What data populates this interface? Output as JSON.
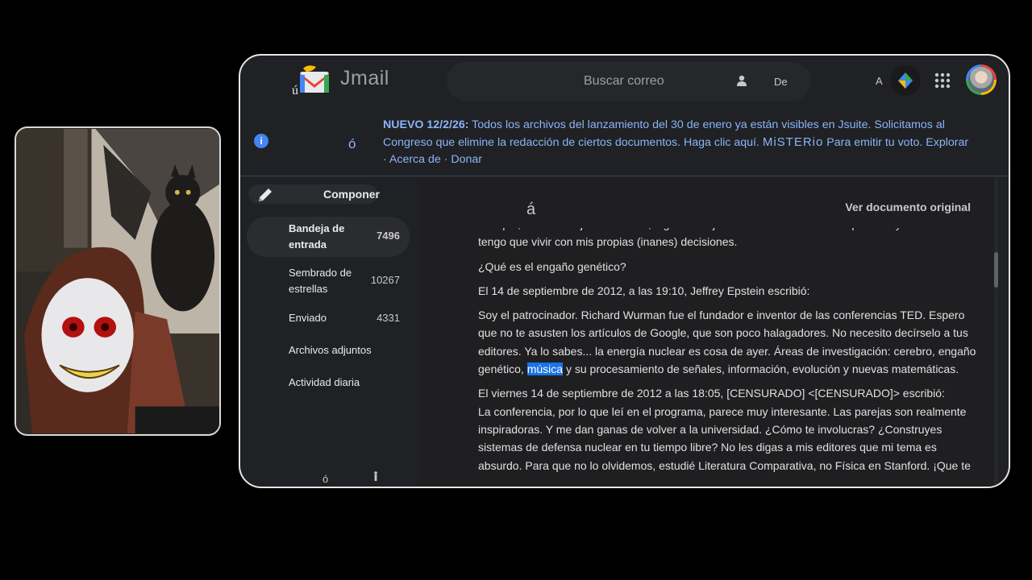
{
  "header": {
    "app_name": "Jmail",
    "search_placeholder": "Buscar correo",
    "from_label": "De",
    "to_label": "A"
  },
  "banner": {
    "icon": "info-icon",
    "glyph": "ó",
    "prefix": "NUEVO 12/2/26:",
    "text": " Todos los archivos del lanzamiento del 30 de enero ya están visibles en Jsuite. Solicitamos al Congreso que elimine la redacción de ciertos documentos. Haga clic aquí. ",
    "brand": "MiSTERio",
    "text2": " Para emitir tu voto. ",
    "link_explore": "Explorar",
    "sep": " · ",
    "link_about": "Acerca de",
    "link_donate": "Donar"
  },
  "sidebar": {
    "compose_label": "Componer",
    "items": [
      {
        "label": "Bandeja de entrada",
        "count": "7496"
      },
      {
        "label": "Sembrado de estrellas",
        "count": "10267"
      },
      {
        "label": "Enviado",
        "count": "4331"
      },
      {
        "label": "Archivos adjuntos",
        "count": ""
      },
      {
        "label": "Actividad diaria",
        "count": ""
      }
    ],
    "bottom_glyph": "ó"
  },
  "email": {
    "glyph": "á",
    "view_original": "Ver documento original",
    "p0": "vez que, si se las deja a su suerte, algunas mujeres tienen demasiadas. Y por eso: yo también tengo que vivir con mis propias (inanes) decisiones.",
    "p1": "¿Qué es el engaño genético?",
    "p2": "El 14 de septiembre de 2012, a las 19:10, Jeffrey Epstein escribió:",
    "p3a": "Soy el patrocinador. Richard Wurman fue el fundador e inventor de las conferencias TED. Espero que no te asusten los artículos de Google, que son poco halagadores. No necesito decírselo a tus editores. Ya lo sabes... la energía nuclear es cosa de ayer. Áreas de investigación: cerebro, engaño genético, ",
    "p3_highlight": "música",
    "p3b": " y su procesamiento de señales, información, evolución y nuevas matemáticas.",
    "p4a": "El viernes 14 de septiembre de 2012 a las 18:05, [CENSURADO] <[CENSURADO]> escribió:",
    "p4b": "La conferencia, por lo que leí en el programa, parece muy interesante. Las parejas son realmente inspiradoras. Y me dan ganas de volver a la universidad. ¿Cómo te involucras? ¿Construyes sistemas de defensa nuclear en tu tiempo libre? No les digas a mis editores que mi tema es absurdo. Para que no lo olvidemos, estudié Literatura Comparativa, no Física en Stanford. ¡Que te"
  },
  "colors": {
    "accent": "#8ab4f8",
    "highlight": "#1a73e8",
    "background": "#202124"
  }
}
